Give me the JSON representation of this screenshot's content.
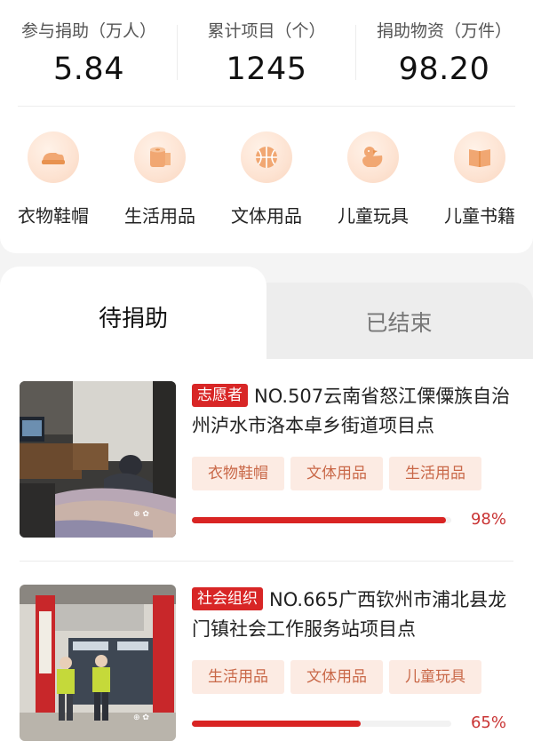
{
  "stats": [
    {
      "label": "参与捐助（万人）",
      "value": "5.84"
    },
    {
      "label": "累计项目（个）",
      "value": "1245"
    },
    {
      "label": "捐助物资（万件）",
      "value": "98.20"
    }
  ],
  "categories": [
    {
      "label": "衣物鞋帽",
      "icon": "clothing-icon"
    },
    {
      "label": "生活用品",
      "icon": "tissue-roll-icon"
    },
    {
      "label": "文体用品",
      "icon": "basketball-icon"
    },
    {
      "label": "儿童玩具",
      "icon": "duck-toy-icon"
    },
    {
      "label": "儿童书籍",
      "icon": "book-icon"
    }
  ],
  "tabs": [
    {
      "label": "待捐助",
      "active": true
    },
    {
      "label": "已结束",
      "active": false
    }
  ],
  "projects": [
    {
      "badge": "志愿者",
      "title": "NO.507云南省怒江傈僳族自治州泸水市洛本卓乡街道项目点",
      "tags": [
        "衣物鞋帽",
        "文体用品",
        "生活用品"
      ],
      "progress": 0.98,
      "progress_label": "98%"
    },
    {
      "badge": "社会组织",
      "title": "NO.665广西钦州市浦北县龙门镇社会工作服务站项目点",
      "tags": [
        "生活用品",
        "文体用品",
        "儿童玩具"
      ],
      "progress": 0.65,
      "progress_label": "65%"
    }
  ],
  "colors": {
    "accent": "#d92423",
    "tag_bg": "#fcebe3",
    "tag_text": "#c96848",
    "icon": "#f1a772"
  }
}
